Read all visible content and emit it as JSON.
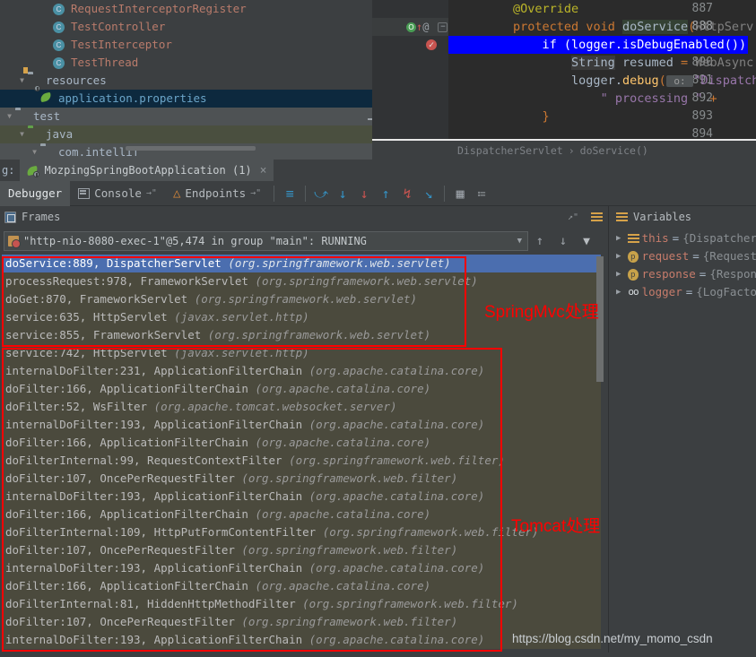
{
  "project_tree": {
    "items": [
      {
        "label": "RequestInterceptorRegister",
        "icon": "class-icon",
        "kind": "class",
        "indent": 3,
        "twisty": "",
        "state": ""
      },
      {
        "label": "TestController",
        "icon": "class-icon",
        "kind": "class",
        "indent": 3,
        "twisty": "",
        "state": ""
      },
      {
        "label": "TestInterceptor",
        "icon": "class-icon",
        "kind": "class",
        "indent": 3,
        "twisty": "",
        "state": ""
      },
      {
        "label": "TestThread",
        "icon": "class-icon",
        "kind": "class",
        "indent": 3,
        "twisty": "",
        "state": ""
      },
      {
        "label": "resources",
        "icon": "folder-resources-icon",
        "kind": "folder-res",
        "indent": 1,
        "twisty": "▼",
        "state": ""
      },
      {
        "label": "application.properties",
        "icon": "spring-properties-icon",
        "kind": "props",
        "indent": 2,
        "twisty": "",
        "state": "sel-blue"
      },
      {
        "label": "test",
        "icon": "folder-icon",
        "kind": "folder",
        "indent": 0,
        "twisty": "▼",
        "state": "sel-gray"
      },
      {
        "label": "java",
        "icon": "folder-green-icon",
        "kind": "folder-green",
        "indent": 1,
        "twisty": "▼",
        "state": "sel-green"
      },
      {
        "label": "com.intellif",
        "icon": "folder-icon",
        "kind": "folder",
        "indent": 2,
        "twisty": "▼",
        "state": "sel-gray"
      }
    ]
  },
  "editor": {
    "lines": [
      {
        "num": "887",
        "current": false,
        "tokens": [
          {
            "t": "        ",
            "c": "k-default"
          },
          {
            "t": "@Override",
            "c": "k-ann"
          }
        ]
      },
      {
        "num": "888",
        "current": true,
        "gutter_icons": [
          "override-method-icon",
          "red-arrow-up-icon",
          "at-icon",
          "fold-minus-icon"
        ],
        "tokens": [
          {
            "t": "        ",
            "c": "k-default"
          },
          {
            "t": "protected",
            "c": "k-kw"
          },
          {
            "t": " ",
            "c": "k-default"
          },
          {
            "t": "void",
            "c": "k-kw"
          },
          {
            "t": " ",
            "c": "k-default"
          },
          {
            "t": "doService",
            "c": "k-default hl-ident"
          },
          {
            "t": "(",
            "c": "k-op"
          },
          {
            "t": "HttpServ",
            "c": "k-gray"
          }
        ]
      },
      {
        "num": "889",
        "current": false,
        "gutter_icons": [
          "breakpoint-verified-icon"
        ],
        "executing": true,
        "tokens": [
          {
            "t": "            ",
            "c": "k-default"
          },
          {
            "t": "if (logger.isDebugEnabled())",
            "c": "k-default"
          }
        ]
      },
      {
        "num": "890",
        "current": false,
        "tokens": [
          {
            "t": "                ",
            "c": "k-default"
          },
          {
            "t": "String",
            "c": "k-default hl-box"
          },
          {
            "t": " resumed ",
            "c": "k-default"
          },
          {
            "t": "=",
            "c": "k-op"
          },
          {
            "t": " WebAsync",
            "c": "k-gray"
          }
        ]
      },
      {
        "num": "891",
        "current": false,
        "tokens": [
          {
            "t": "                ",
            "c": "k-default"
          },
          {
            "t": "logger",
            "c": "k-default"
          },
          {
            "t": ".",
            "c": "k-default"
          },
          {
            "t": "debug",
            "c": "k-meth"
          },
          {
            "t": "(",
            "c": "k-op"
          },
          {
            "t": " o: ",
            "c": "param-hint"
          },
          {
            "t": "\"Dispatch",
            "c": "k-purple"
          }
        ]
      },
      {
        "num": "892",
        "current": false,
        "tokens": [
          {
            "t": "                    ",
            "c": "k-default"
          },
          {
            "t": "\" processing \"",
            "c": "k-purple"
          },
          {
            "t": " +",
            "c": "k-op"
          }
        ]
      },
      {
        "num": "893",
        "current": false,
        "tokens": [
          {
            "t": "            ",
            "c": "k-default"
          },
          {
            "t": "}",
            "c": "k-op"
          }
        ]
      },
      {
        "num": "894",
        "current": false,
        "tokens": []
      }
    ],
    "breadcrumb": {
      "class": "DispatcherServlet",
      "separator": "›",
      "method": "doService()"
    }
  },
  "run_tab": {
    "prefix_label": "g:",
    "title": "MozpingSpringBootApplication (1)",
    "close_label": "×",
    "icon": "spring-boot-icon"
  },
  "debug_toolbar": {
    "tabs": [
      {
        "label": "Debugger",
        "icon": "",
        "active": true,
        "pin": ""
      },
      {
        "label": "Console",
        "icon": "console-icon",
        "active": false,
        "pin": "→\""
      },
      {
        "label": "Endpoints",
        "icon": "endpoints-icon",
        "active": false,
        "pin": "→\""
      }
    ],
    "buttons": [
      {
        "name": "show-execution-point-button",
        "glyph": "≡",
        "color": "#3592c4"
      },
      {
        "name": "step-over-button",
        "glyph": "⤻",
        "color": "#3592c4"
      },
      {
        "name": "step-into-button",
        "glyph": "↓",
        "color": "#3592c4"
      },
      {
        "name": "force-step-into-button",
        "glyph": "↓",
        "color": "#c75450"
      },
      {
        "name": "step-out-button",
        "glyph": "↑",
        "color": "#3592c4"
      },
      {
        "name": "drop-frame-button",
        "glyph": "↯",
        "color": "#c75450"
      },
      {
        "name": "run-to-cursor-button",
        "glyph": "↘",
        "color": "#3592c4"
      },
      {
        "name": "evaluate-expression-button",
        "glyph": "▦",
        "color": "#9aa0a6"
      },
      {
        "name": "settings-button",
        "glyph": "≔",
        "color": "#8a8f93"
      }
    ]
  },
  "frames_panel": {
    "title": "Frames",
    "thread": "\"http-nio-8080-exec-1\"@5,474 in group \"main\": RUNNING",
    "nav": {
      "up": "↑",
      "down": "↓",
      "filter": "▼"
    },
    "frames": [
      {
        "method": "doService:889, DispatcherServlet ",
        "pkg": "(org.springframework.web.servlet)",
        "selected": true,
        "lib": false
      },
      {
        "method": "processRequest:978, FrameworkServlet ",
        "pkg": "(org.springframework.web.servlet)",
        "selected": false,
        "lib": true
      },
      {
        "method": "doGet:870, FrameworkServlet ",
        "pkg": "(org.springframework.web.servlet)",
        "selected": false,
        "lib": true
      },
      {
        "method": "service:635, HttpServlet ",
        "pkg": "(javax.servlet.http)",
        "selected": false,
        "lib": true
      },
      {
        "method": "service:855, FrameworkServlet ",
        "pkg": "(org.springframework.web.servlet)",
        "selected": false,
        "lib": true
      },
      {
        "method": "service:742, HttpServlet ",
        "pkg": "(javax.servlet.http)",
        "selected": false,
        "lib": true
      },
      {
        "method": "internalDoFilter:231, ApplicationFilterChain ",
        "pkg": "(org.apache.catalina.core)",
        "selected": false,
        "lib": true
      },
      {
        "method": "doFilter:166, ApplicationFilterChain ",
        "pkg": "(org.apache.catalina.core)",
        "selected": false,
        "lib": true
      },
      {
        "method": "doFilter:52, WsFilter ",
        "pkg": "(org.apache.tomcat.websocket.server)",
        "selected": false,
        "lib": true
      },
      {
        "method": "internalDoFilter:193, ApplicationFilterChain ",
        "pkg": "(org.apache.catalina.core)",
        "selected": false,
        "lib": true
      },
      {
        "method": "doFilter:166, ApplicationFilterChain ",
        "pkg": "(org.apache.catalina.core)",
        "selected": false,
        "lib": true
      },
      {
        "method": "doFilterInternal:99, RequestContextFilter ",
        "pkg": "(org.springframework.web.filter)",
        "selected": false,
        "lib": true
      },
      {
        "method": "doFilter:107, OncePerRequestFilter ",
        "pkg": "(org.springframework.web.filter)",
        "selected": false,
        "lib": true
      },
      {
        "method": "internalDoFilter:193, ApplicationFilterChain ",
        "pkg": "(org.apache.catalina.core)",
        "selected": false,
        "lib": true
      },
      {
        "method": "doFilter:166, ApplicationFilterChain ",
        "pkg": "(org.apache.catalina.core)",
        "selected": false,
        "lib": true
      },
      {
        "method": "doFilterInternal:109, HttpPutFormContentFilter ",
        "pkg": "(org.springframework.web.filter)",
        "selected": false,
        "lib": true
      },
      {
        "method": "doFilter:107, OncePerRequestFilter ",
        "pkg": "(org.springframework.web.filter)",
        "selected": false,
        "lib": true
      },
      {
        "method": "internalDoFilter:193, ApplicationFilterChain ",
        "pkg": "(org.apache.catalina.core)",
        "selected": false,
        "lib": true
      },
      {
        "method": "doFilter:166, ApplicationFilterChain ",
        "pkg": "(org.apache.catalina.core)",
        "selected": false,
        "lib": true
      },
      {
        "method": "doFilterInternal:81, HiddenHttpMethodFilter ",
        "pkg": "(org.springframework.web.filter)",
        "selected": false,
        "lib": true
      },
      {
        "method": "doFilter:107, OncePerRequestFilter ",
        "pkg": "(org.springframework.web.filter)",
        "selected": false,
        "lib": true
      },
      {
        "method": "internalDoFilter:193, ApplicationFilterChain ",
        "pkg": "(org.apache.catalina.core)",
        "selected": false,
        "lib": true
      }
    ]
  },
  "variables_panel": {
    "title": "Variables",
    "rows": [
      {
        "arrow": "▶",
        "icon": "stack-icon",
        "name": "this",
        "eq": " = ",
        "value": "{Dispatcher"
      },
      {
        "arrow": "▶",
        "icon": "param-icon",
        "name": "request",
        "eq": " = ",
        "value": "{Request"
      },
      {
        "arrow": "▶",
        "icon": "param-icon",
        "name": "response",
        "eq": " = ",
        "value": "{Respon"
      },
      {
        "arrow": "▶",
        "icon": "field-icon",
        "name": "logger",
        "eq": " = ",
        "value": "{LogFacto"
      }
    ]
  },
  "annotations": {
    "spring_label": "SpringMvc处理",
    "tomcat_label": "Tomcat处理",
    "accent_color": "#ff0000"
  },
  "watermark": {
    "url": "https://blog.csdn.net/my_momo_csdn"
  }
}
